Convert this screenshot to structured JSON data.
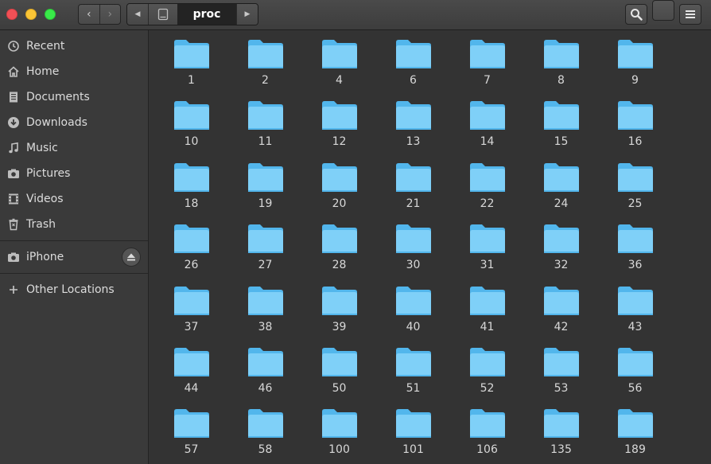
{
  "header": {
    "back_glyph": "‹",
    "forward_glyph": "›",
    "path_left_glyph": "◀",
    "path_right_glyph": "▶",
    "current_folder": "proc"
  },
  "sidebar": {
    "items": [
      {
        "label": "Recent",
        "icon": "recent-icon"
      },
      {
        "label": "Home",
        "icon": "home-icon"
      },
      {
        "label": "Documents",
        "icon": "documents-icon"
      },
      {
        "label": "Downloads",
        "icon": "downloads-icon"
      },
      {
        "label": "Music",
        "icon": "music-icon"
      },
      {
        "label": "Pictures",
        "icon": "pictures-icon"
      },
      {
        "label": "Videos",
        "icon": "videos-icon"
      },
      {
        "label": "Trash",
        "icon": "trash-icon"
      }
    ],
    "devices": [
      {
        "label": "iPhone",
        "icon": "camera-icon"
      }
    ],
    "other": {
      "label": "Other Locations",
      "icon": "plus-icon"
    }
  },
  "folders": [
    "1",
    "2",
    "4",
    "6",
    "7",
    "8",
    "9",
    "10",
    "11",
    "12",
    "13",
    "14",
    "15",
    "16",
    "18",
    "19",
    "20",
    "21",
    "22",
    "24",
    "25",
    "26",
    "27",
    "28",
    "30",
    "31",
    "32",
    "36",
    "37",
    "38",
    "39",
    "40",
    "41",
    "42",
    "43",
    "44",
    "46",
    "50",
    "51",
    "52",
    "53",
    "56",
    "57",
    "58",
    "100",
    "101",
    "106",
    "135",
    "189"
  ],
  "colors": {
    "folder_light": "#7fd0f8",
    "folder_dark": "#52b6ec",
    "background": "#333333",
    "sidebar": "#3a3a3a"
  }
}
